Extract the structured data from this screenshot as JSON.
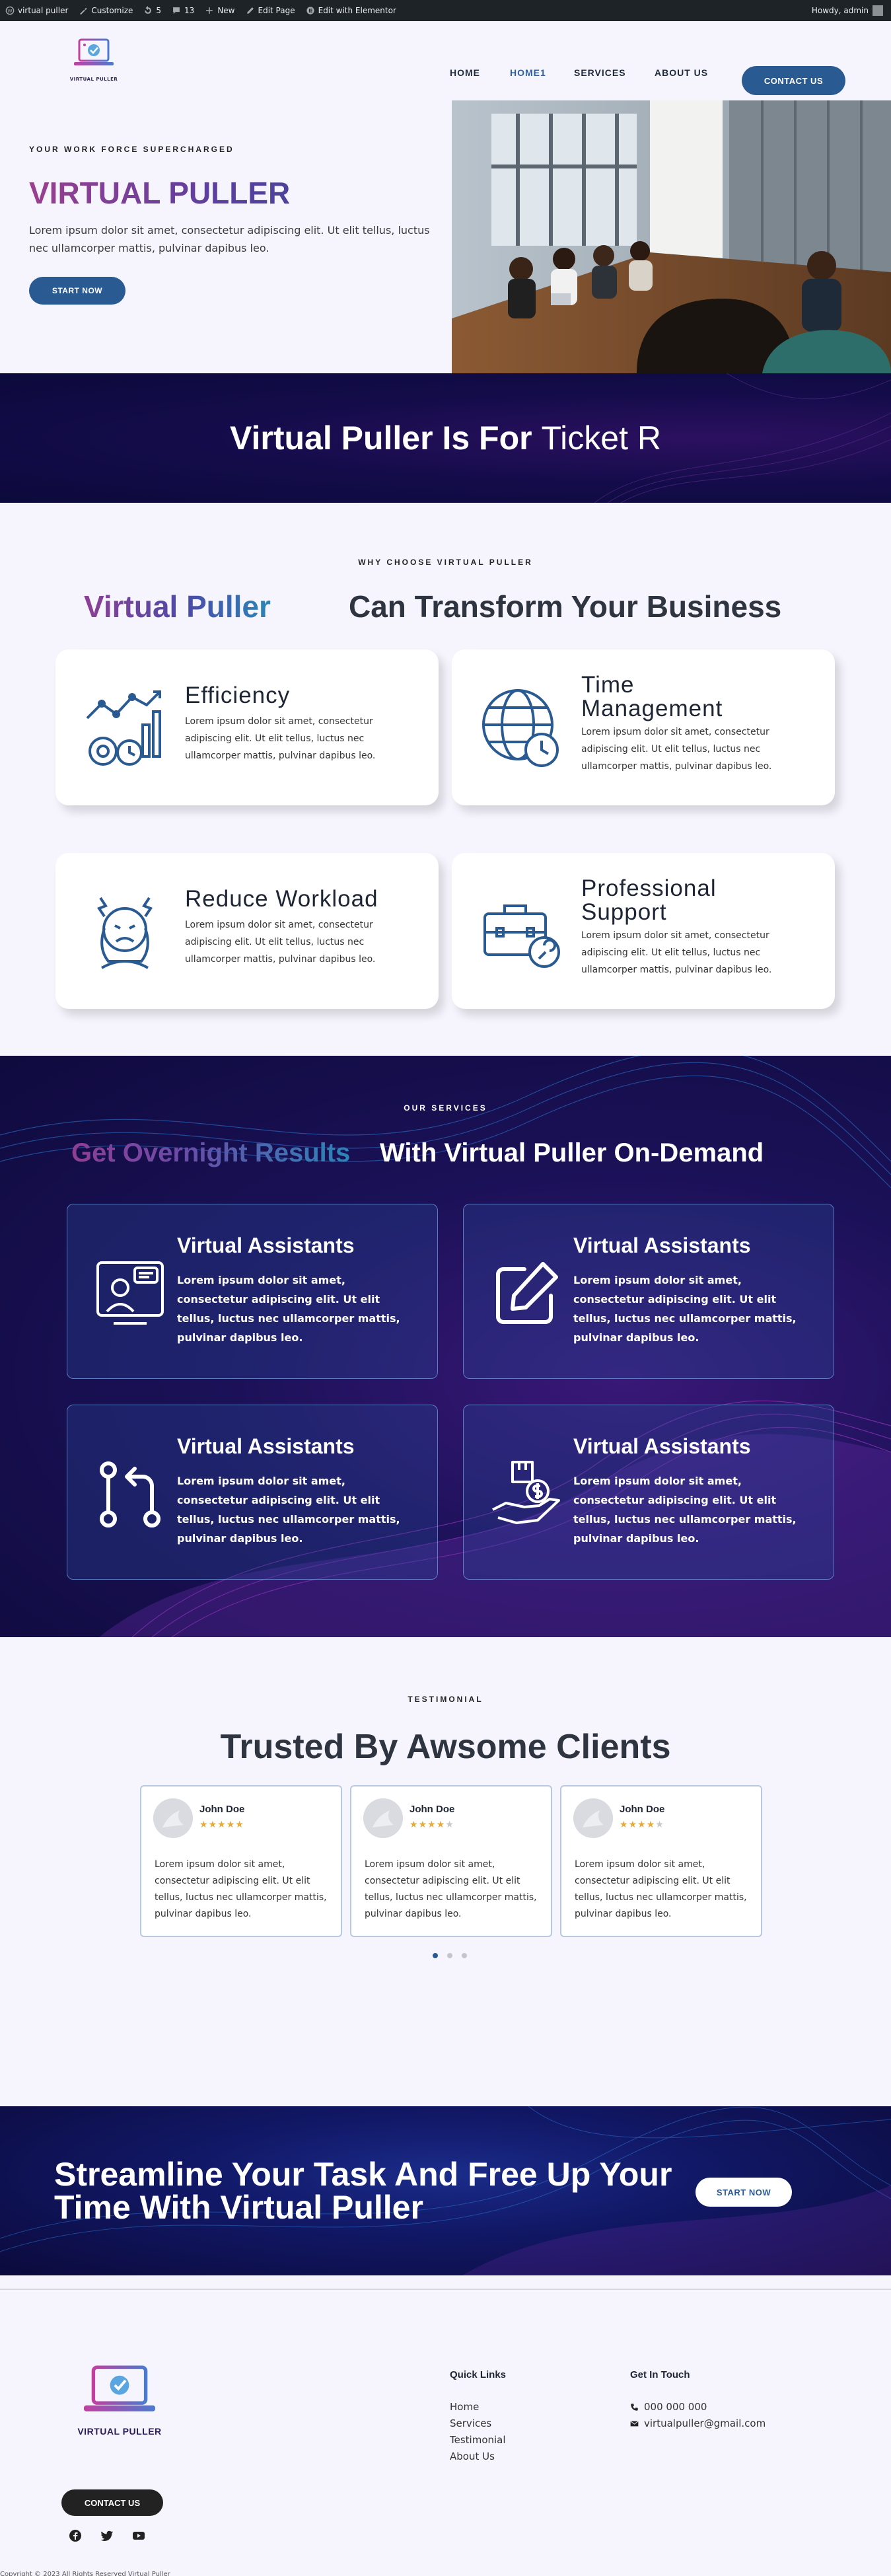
{
  "adminbar": {
    "site": "virtual puller",
    "customize": "Customize",
    "updates": "5",
    "comments": "13",
    "new": "New",
    "edit_page": "Edit Page",
    "elementor": "Edit with Elementor",
    "howdy": "Howdy, admin"
  },
  "header": {
    "logo_text": "VIRTUAL PULLER",
    "nav": [
      "HOME",
      "HOME1",
      "SERVICES",
      "ABOUT US"
    ],
    "contact_button": "CONTACT US"
  },
  "hero": {
    "kicker": "YOUR WORK FORCE SUPERCHARGED",
    "title": "VIRTUAL PULLER",
    "text": "Lorem ipsum dolor sit amet, consectetur adipiscing elit. Ut elit tellus, luctus nec ullamcorper mattis, pulvinar dapibus leo.",
    "button": "START NOW"
  },
  "banner": {
    "title_bold": "Virtual Puller Is For ",
    "title_typed": "Ticket R"
  },
  "why": {
    "kicker": "WHY CHOOSE VIRTUAL PULLER",
    "title_a": "Virtual Puller",
    "title_b": "Can Transform Your Business",
    "features": [
      {
        "title": "Efficiency",
        "icon": "efficiency-chart-gear-icon",
        "text": "Lorem ipsum dolor sit amet, consectetur adipiscing elit. Ut elit tellus, luctus nec ullamcorper mattis, pulvinar dapibus leo."
      },
      {
        "title": "Time Management",
        "icon": "globe-clock-icon",
        "text": "Lorem ipsum dolor sit amet, consectetur adipiscing elit. Ut elit tellus, luctus nec ullamcorper mattis, pulvinar dapibus leo."
      },
      {
        "title": "Reduce Workload",
        "icon": "stressed-person-icon",
        "text": "Lorem ipsum dolor sit amet, consectetur adipiscing elit. Ut elit tellus, luctus nec ullamcorper mattis, pulvinar dapibus leo."
      },
      {
        "title": "Professional Support",
        "icon": "toolbox-wrench-icon",
        "text": "Lorem ipsum dolor sit amet, consectetur adipiscing elit. Ut elit tellus, luctus nec ullamcorper mattis, pulvinar dapibus leo."
      }
    ]
  },
  "services": {
    "kicker": "OUR SERVICES",
    "title_a": "Get Overnight Results",
    "title_b": "With Virtual Puller On-Demand",
    "cards": [
      {
        "title": "Virtual Assistants",
        "icon": "support-agent-icon",
        "text": "Lorem ipsum dolor sit amet, consectetur adipiscing elit. Ut elit tellus, luctus nec ullamcorper mattis, pulvinar dapibus leo."
      },
      {
        "title": "Virtual Assistants",
        "icon": "edit-square-icon",
        "text": "Lorem ipsum dolor sit amet, consectetur adipiscing elit. Ut elit tellus, luctus nec ullamcorper mattis, pulvinar dapibus leo."
      },
      {
        "title": "Virtual Assistants",
        "icon": "git-pull-icon",
        "text": "Lorem ipsum dolor sit amet, consectetur adipiscing elit. Ut elit tellus, luctus nec ullamcorper mattis, pulvinar dapibus leo."
      },
      {
        "title": "Virtual Assistants",
        "icon": "hand-box-dollar-icon",
        "text": "Lorem ipsum dolor sit amet, consectetur adipiscing elit. Ut elit tellus, luctus nec ullamcorper mattis, pulvinar dapibus leo."
      }
    ]
  },
  "testimonials": {
    "kicker": "TESTIMONIAL",
    "title": "Trusted By Awsome Clients",
    "items": [
      {
        "name": "John Doe",
        "rating": 5,
        "text": "Lorem ipsum dolor sit amet, consectetur adipiscing elit. Ut elit tellus, luctus nec ullamcorper mattis, pulvinar dapibus leo."
      },
      {
        "name": "John Doe",
        "rating": 4,
        "text": "Lorem ipsum dolor sit amet, consectetur adipiscing elit. Ut elit tellus, luctus nec ullamcorper mattis, pulvinar dapibus leo."
      },
      {
        "name": "John Doe",
        "rating": 4,
        "text": "Lorem ipsum dolor sit amet, consectetur adipiscing elit. Ut elit tellus, luctus nec ullamcorper mattis, pulvinar dapibus leo."
      }
    ],
    "active_dot": 0,
    "dot_count": 3
  },
  "cta": {
    "title": "Streamline Your Task And Free Up Your Time With Virtual Puller",
    "button": "START NOW"
  },
  "footer": {
    "logo_text": "VIRTUAL PULLER",
    "contact_button": "CONTACT US",
    "quick_links_title": "Quick Links",
    "quick_links": [
      "Home",
      "Services",
      "Testimonial",
      "About Us"
    ],
    "get_in_touch_title": "Get In Touch",
    "phone": "000 000 000",
    "email": "virtualpuller@gmail.com",
    "copyright": "Copyright © 2023 All Rights Reserved Virtual Puller"
  },
  "colors": {
    "primary": "#2a5a92",
    "dark_navy": "#0c0a3c",
    "purple": "#9a3f8e",
    "star": "#e2a93b"
  }
}
